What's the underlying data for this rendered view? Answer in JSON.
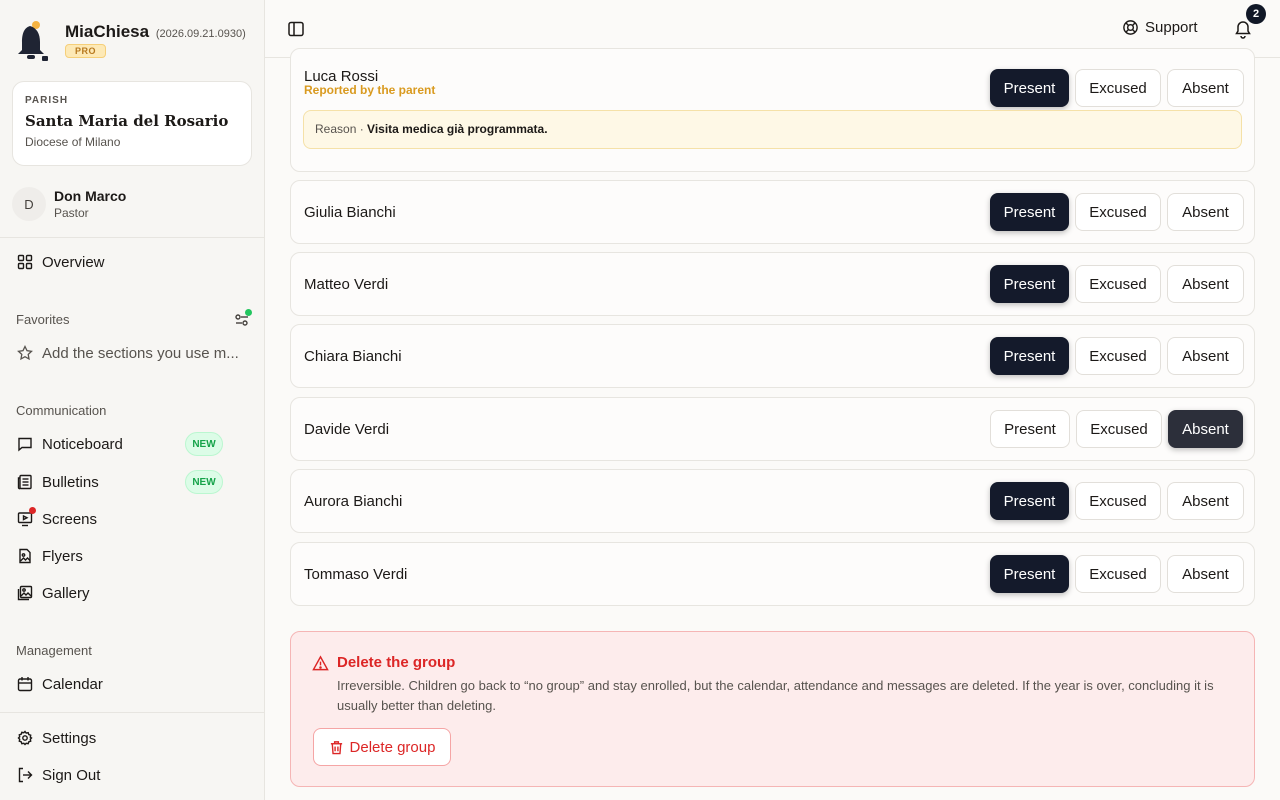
{
  "app": {
    "name": "MiaChiesa",
    "version": "(2026.09.21.0930)",
    "plan": "PRO"
  },
  "parish": {
    "label": "PARISH",
    "name": "Santa Maria del Rosario",
    "diocese": "Diocese of Milano"
  },
  "user": {
    "initial": "D",
    "name": "Don Marco",
    "role": "Pastor"
  },
  "nav": {
    "overview": "Overview",
    "favorites_title": "Favorites",
    "favorites_hint": "Add the sections you use m...",
    "communication_title": "Communication",
    "noticeboard": "Noticeboard",
    "bulletins": "Bulletins",
    "screens": "Screens",
    "flyers": "Flyers",
    "gallery": "Gallery",
    "new_badge": "NEW",
    "management_title": "Management",
    "calendar": "Calendar",
    "settings": "Settings",
    "sign_out": "Sign Out"
  },
  "header": {
    "support": "Support",
    "notifications_count": "2"
  },
  "attendance": {
    "labels": {
      "present": "Present",
      "excused": "Excused",
      "absent": "Absent"
    },
    "reason_prefix": "Reason ·",
    "rows": [
      {
        "name": "Luca Rossi",
        "status": "present",
        "note": "Reported by the parent",
        "reason": "Visita medica già programmata."
      },
      {
        "name": "Giulia Bianchi",
        "status": "present"
      },
      {
        "name": "Matteo Verdi",
        "status": "present"
      },
      {
        "name": "Chiara Bianchi",
        "status": "present"
      },
      {
        "name": "Davide Verdi",
        "status": "absent"
      },
      {
        "name": "Aurora Bianchi",
        "status": "present"
      },
      {
        "name": "Tommaso Verdi",
        "status": "present"
      }
    ]
  },
  "danger_zone": {
    "title": "Delete the group",
    "text": "Irreversible. Children go back to “no group” and stay enrolled, but the calendar, attendance and messages are deleted. If the year is over, concluding it is usually better than deleting.",
    "button": "Delete group"
  },
  "colors": {
    "accent_dark": "#141a2b",
    "danger": "#dc2626",
    "new_green": "#16a34a",
    "note_amber": "#d99a1f"
  }
}
